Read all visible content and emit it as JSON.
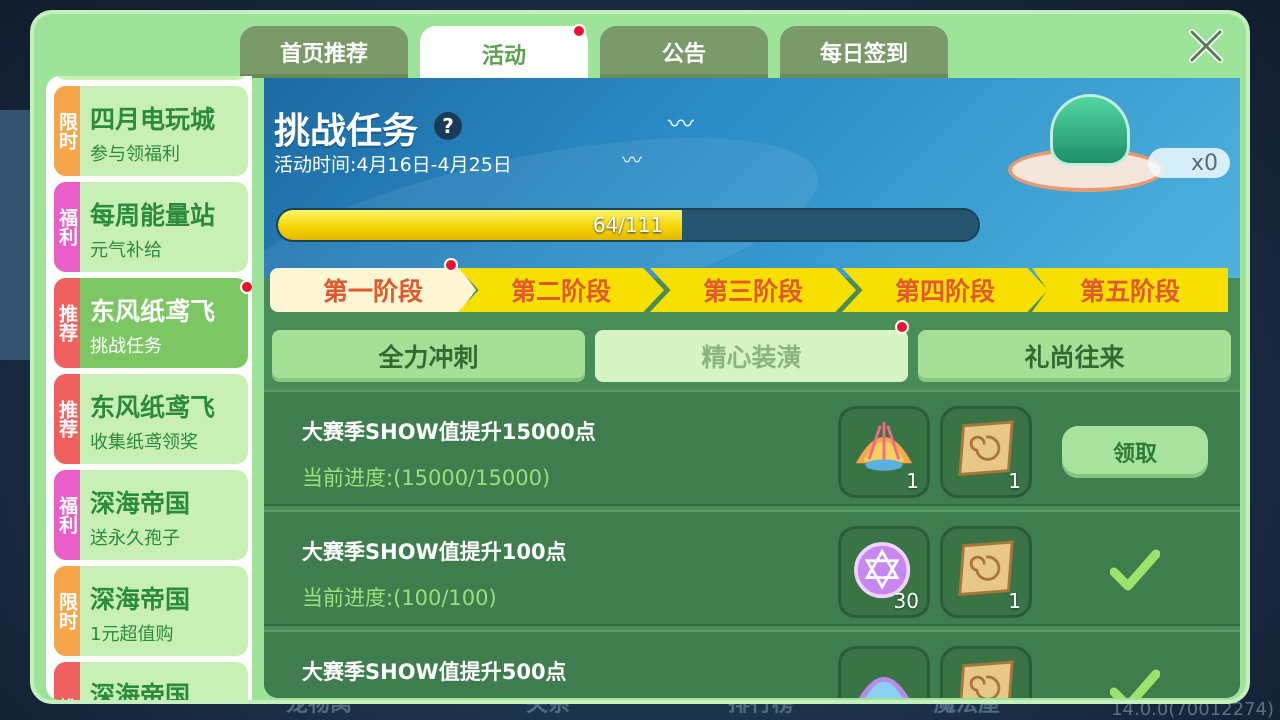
{
  "top_tabs": [
    {
      "label": "首页推荐"
    },
    {
      "label": "活动"
    },
    {
      "label": "公告"
    },
    {
      "label": "每日签到"
    }
  ],
  "sidebar": {
    "items": [
      {
        "tag": "限时",
        "title": "四月电玩城",
        "sub": "参与领福利"
      },
      {
        "tag": "福利",
        "title": "每周能量站",
        "sub": "元气补给"
      },
      {
        "tag": "推荐",
        "title": "东风纸鸢飞",
        "sub": "挑战任务"
      },
      {
        "tag": "推荐",
        "title": "东风纸鸢飞",
        "sub": "收集纸鸢领奖"
      },
      {
        "tag": "福利",
        "title": "深海帝国",
        "sub": "送永久孢子"
      },
      {
        "tag": "限时",
        "title": "深海帝国",
        "sub": "1元超值购"
      },
      {
        "tag": "推",
        "title": "深海帝国",
        "sub": ""
      }
    ]
  },
  "banner": {
    "title": "挑战任务",
    "help": "?",
    "time": "活动时间:4月16日-4月25日",
    "progress_text": "64/111",
    "progress_fraction": 0.577,
    "chest_count": "x0"
  },
  "stages": [
    "第一阶段",
    "第二阶段",
    "第三阶段",
    "第四阶段",
    "第五阶段"
  ],
  "subtabs": [
    "全力冲刺",
    "精心装潢",
    "礼尚往来"
  ],
  "tasks": [
    {
      "title": "大赛季SHOW值提升15000点",
      "progress": "当前进度:(15000/15000)",
      "reward1_qty": "1",
      "reward2_qty": "1",
      "action": "领取"
    },
    {
      "title": "大赛季SHOW值提升100点",
      "progress": "当前进度:(100/100)",
      "reward1_qty": "30",
      "reward2_qty": "1"
    },
    {
      "title": "大赛季SHOW值提升500点"
    }
  ],
  "background": {
    "bottom_nav": [
      "宠物窝",
      "关系",
      "排行榜",
      "魔法屋"
    ],
    "version": "14.0.0(70012274)"
  },
  "colors": {
    "panel": "#9ee39a",
    "content": "#4a8c58",
    "stage_yellow": "#f7e000",
    "stage_text": "#e0582b",
    "red_dot": "#ee1133",
    "progress_fill": "#f4d400"
  }
}
